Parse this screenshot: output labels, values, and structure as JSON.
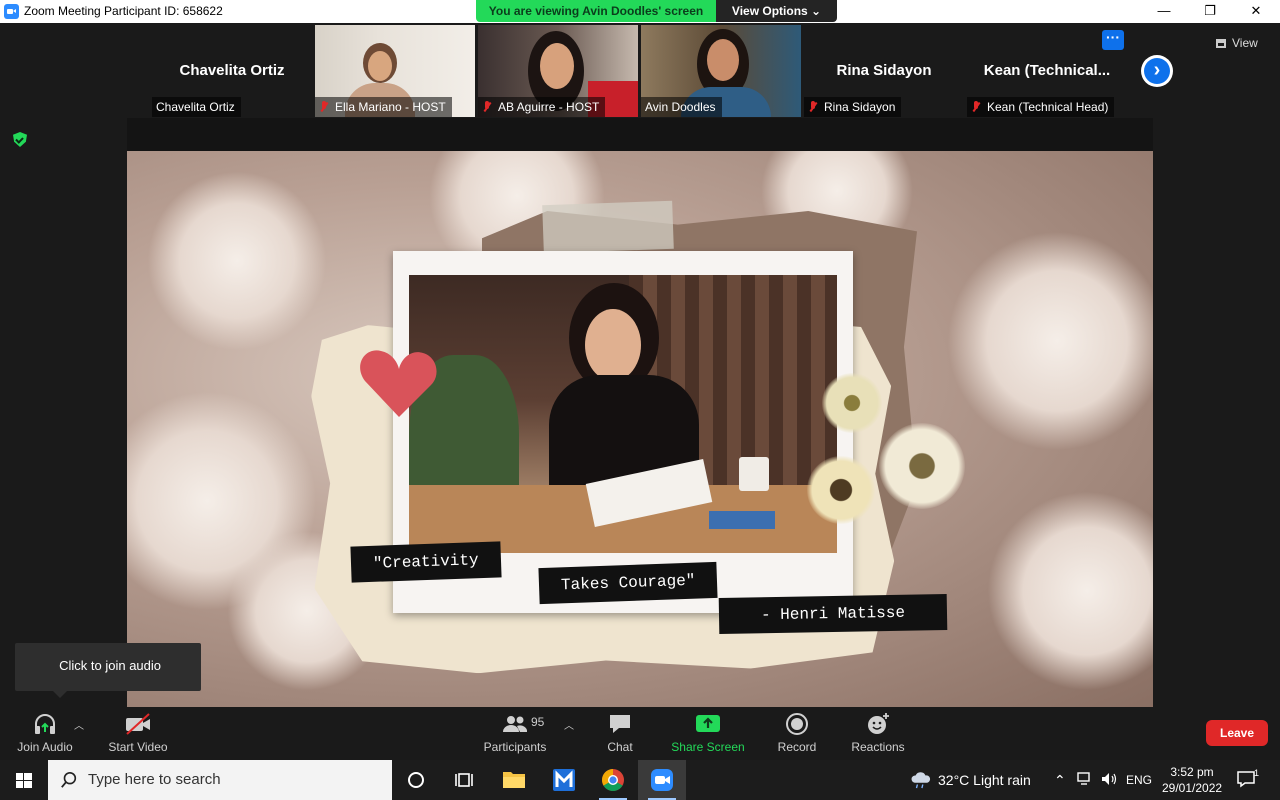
{
  "window": {
    "title": "Zoom Meeting Participant ID: 658622",
    "controls": {
      "minimize": "—",
      "restore": "❐",
      "close": "✕"
    }
  },
  "share_banner": {
    "text": "You are viewing Avin Doodles' screen",
    "view_options": "View Options ⌄",
    "color": "#23d959"
  },
  "gallery": {
    "tiles": [
      {
        "big_name": "Chavelita Ortiz",
        "name_tag": "Chavelita Ortiz",
        "muted": false,
        "video": false
      },
      {
        "big_name": "",
        "name_tag": "Ella Mariano - HOST",
        "muted": true,
        "video": true
      },
      {
        "big_name": "",
        "name_tag": "AB Aguirre - HOST",
        "muted": true,
        "video": true
      },
      {
        "big_name": "",
        "name_tag": "Avin Doodles",
        "muted": false,
        "video": true,
        "active": true
      },
      {
        "big_name": "Rina Sidayon",
        "name_tag": "Rina Sidayon",
        "muted": true,
        "video": false
      },
      {
        "big_name": "Kean  (Technical...",
        "name_tag": "Kean (Technical Head)",
        "muted": true,
        "video": false
      }
    ],
    "more_icon": "ellipsis-icon",
    "next_icon": "chevron-right-icon",
    "view_label": "View"
  },
  "shared_content": {
    "quote_lines": [
      "\"Creativity",
      "Takes Courage\"",
      "- Henri Matisse"
    ]
  },
  "tooltip": {
    "text": "Click to join audio"
  },
  "toolbar": {
    "join_audio": "Join Audio",
    "start_video": "Start Video",
    "participants": "Participants",
    "participants_count": "95",
    "chat": "Chat",
    "share_screen": "Share Screen",
    "record": "Record",
    "reactions": "Reactions",
    "leave": "Leave",
    "accent": "#23d959",
    "leave_color": "#e02828"
  },
  "taskbar": {
    "search_placeholder": "Type here to search",
    "weather": "32°C  Light rain",
    "language": "ENG",
    "time": "3:52 pm",
    "date": "29/01/2022",
    "notification_count": "1"
  }
}
